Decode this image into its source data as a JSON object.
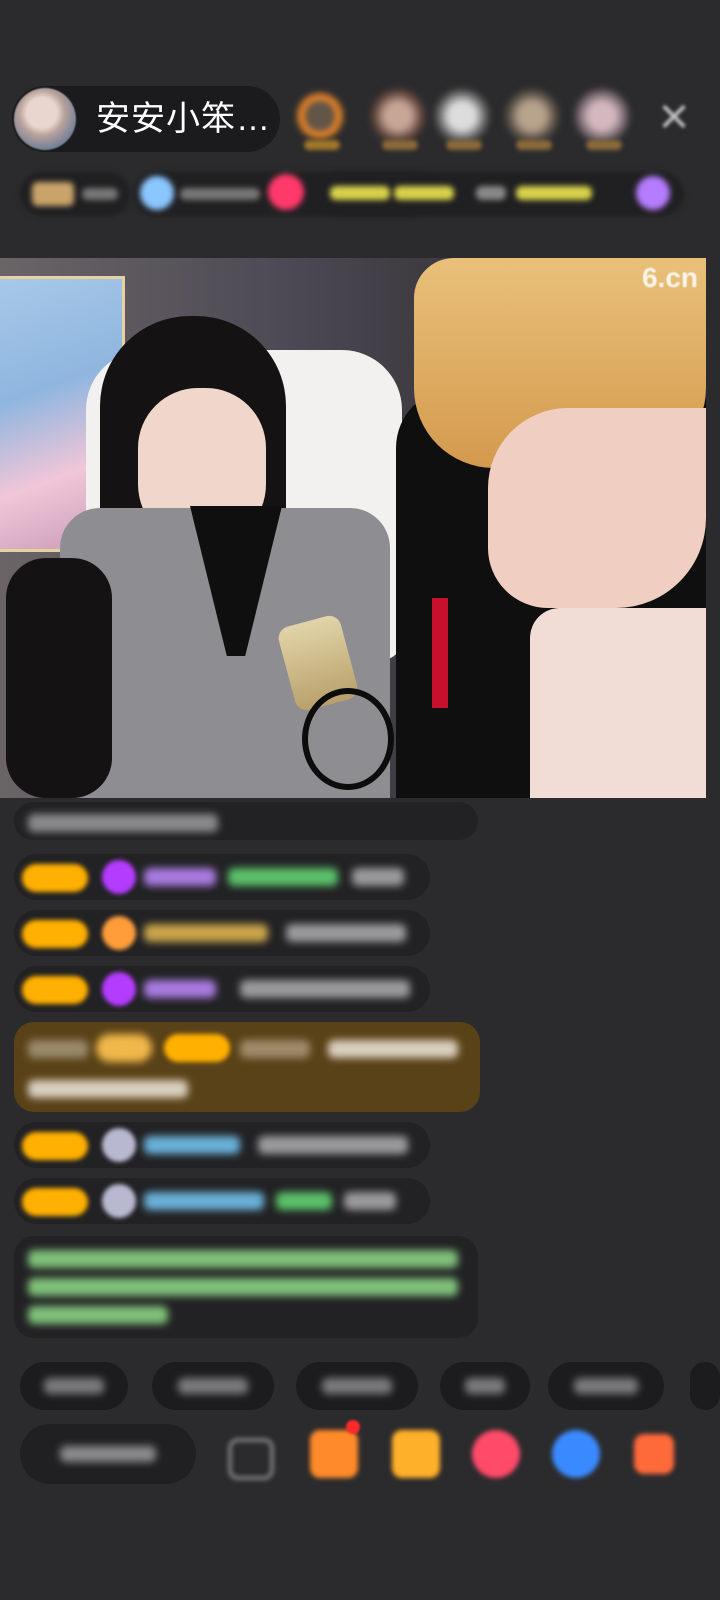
{
  "header": {
    "host_name": "安安小笨…",
    "close_icon": "close-icon"
  },
  "video": {
    "watermark": "6.cn"
  },
  "colors": {
    "background": "#2b2b2d",
    "badge_yellow": "#ffb000",
    "gem_purple": "#b43cff",
    "highlight_row": "#5a4218"
  }
}
